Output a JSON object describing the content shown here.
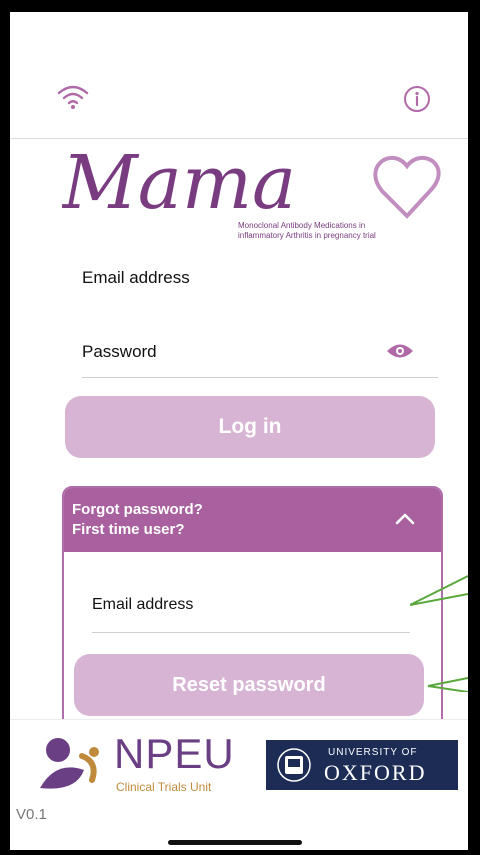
{
  "logo": {
    "wordmark": "Mama",
    "subtitle_line1": "Monoclonal Antibody Medications in",
    "subtitle_line2": "inflammatory Arthritis in pregnancy trial"
  },
  "topbar": {
    "wifi_icon": "wifi-icon",
    "info_icon": "info-icon"
  },
  "login": {
    "email_label": "Email address",
    "password_label": "Password",
    "login_button": "Log in"
  },
  "forgot": {
    "title_line1": "Forgot password?",
    "title_line2": "First time user?",
    "email_label": "Email address",
    "reset_button": "Reset password"
  },
  "footer": {
    "npeu_name": "NPEU",
    "npeu_sub": "Clinical Trials Unit",
    "oxford_small": "UNIVERSITY OF",
    "oxford_big": "OXFORD",
    "version": "V0.1"
  },
  "colors": {
    "accent": "#a8609f",
    "button": "#d7b3d4",
    "logo_purple": "#7a3c80"
  }
}
